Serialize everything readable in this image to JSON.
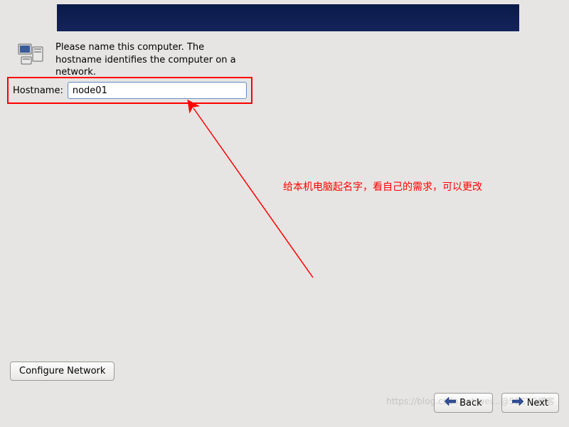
{
  "instruction": "Please name this computer.  The hostname identifies the computer on a network.",
  "hostname": {
    "label": "Hostname:",
    "value": "node01"
  },
  "annotation": "给本机电脑起名字，看自己的需求，可以更改",
  "buttons": {
    "configure_network": "Configure Network",
    "back": "Back",
    "next": "Next"
  },
  "watermark": "https://blog.csdn.net/wei...@51CTO博客"
}
